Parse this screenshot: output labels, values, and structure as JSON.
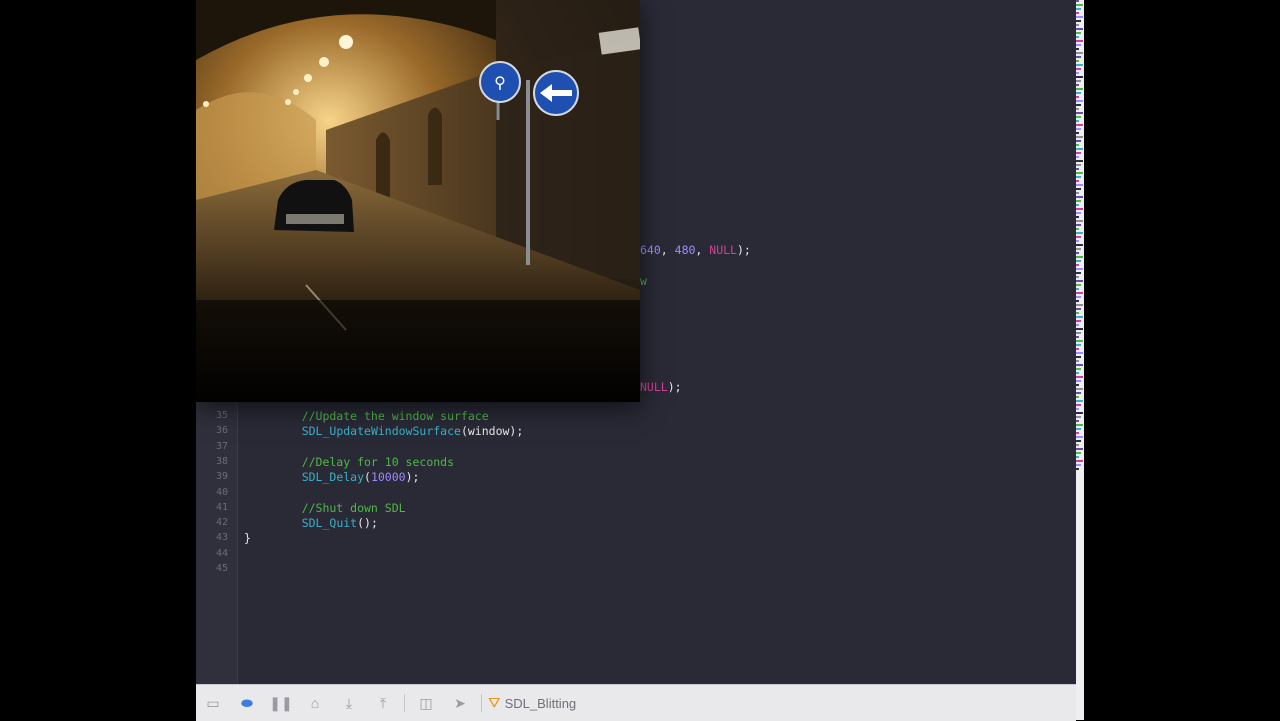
{
  "editor": {
    "line_numbers": [
      "35",
      "36",
      "37",
      "38",
      "39",
      "40",
      "41",
      "42",
      "43",
      "44",
      "45"
    ],
    "lines": [
      {
        "n": "35",
        "parts": [
          {
            "t": "    //Update the window surface",
            "c": "c-com"
          }
        ]
      },
      {
        "n": "36",
        "parts": [
          {
            "t": "    ",
            "c": "c-pl"
          },
          {
            "t": "SDL_UpdateWindowSurface",
            "c": "c-fn"
          },
          {
            "t": "(window);",
            "c": "c-pl"
          }
        ]
      },
      {
        "n": "37",
        "parts": []
      },
      {
        "n": "38",
        "parts": [
          {
            "t": "    //Delay for 10 seconds",
            "c": "c-com"
          }
        ]
      },
      {
        "n": "39",
        "parts": [
          {
            "t": "    ",
            "c": "c-pl"
          },
          {
            "t": "SDL_Delay",
            "c": "c-fn"
          },
          {
            "t": "(",
            "c": "c-pl"
          },
          {
            "t": "10000",
            "c": "c-num"
          },
          {
            "t": ");",
            "c": "c-pl"
          }
        ]
      },
      {
        "n": "40",
        "parts": []
      },
      {
        "n": "41",
        "parts": [
          {
            "t": "    //Shut down SDL",
            "c": "c-com"
          }
        ]
      },
      {
        "n": "42",
        "parts": [
          {
            "t": "    ",
            "c": "c-pl"
          },
          {
            "t": "SDL_Quit",
            "c": "c-fn"
          },
          {
            "t": "();",
            "c": "c-pl"
          }
        ]
      },
      {
        "n": "43",
        "parts": [
          {
            "t": "}",
            "c": "c-pl"
          }
        ]
      },
      {
        "n": "44",
        "parts": []
      },
      {
        "n": "45",
        "parts": []
      }
    ],
    "fragments": {
      "f1_num1": "640",
      "f1_sep": ", ",
      "f1_num2": "480",
      "f1_sep2": ", ",
      "f1_kw": "NULL",
      "f1_end": ");",
      "f2": "w",
      "f3_kw": "NULL",
      "f3_end": ");"
    }
  },
  "debugbar": {
    "target_name": "SDL_Blitting"
  },
  "colors": {
    "editor_bg": "#292a36",
    "comment": "#4fb848",
    "function": "#39b1c8",
    "number": "#9d8bff",
    "keyword": "#d2409b"
  }
}
